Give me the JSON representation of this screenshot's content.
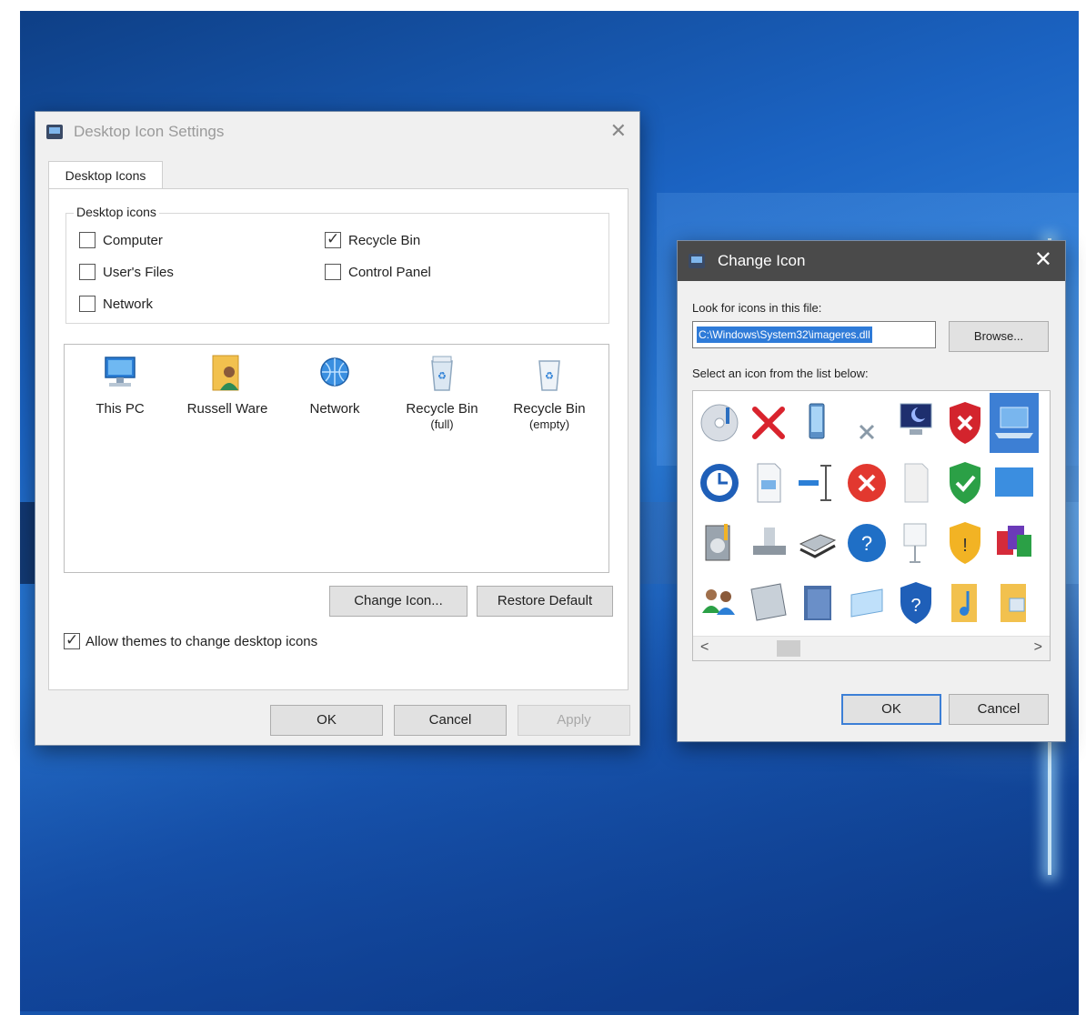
{
  "desktop_icon_settings": {
    "title": "Desktop Icon Settings",
    "close_glyph": "✕",
    "tab_label": "Desktop Icons",
    "group_label": "Desktop icons",
    "checkboxes": [
      {
        "label": "Computer",
        "checked": false
      },
      {
        "label": "Recycle Bin",
        "checked": true
      },
      {
        "label": "User's Files",
        "checked": false
      },
      {
        "label": "Control Panel",
        "checked": false
      },
      {
        "label": "Network",
        "checked": false
      }
    ],
    "icons": [
      {
        "label": "This PC",
        "sub": "",
        "icon": "pc-icon"
      },
      {
        "label": "Russell Ware",
        "sub": "",
        "icon": "user-folder-icon"
      },
      {
        "label": "Network",
        "sub": "",
        "icon": "network-icon"
      },
      {
        "label": "Recycle Bin",
        "sub": "(full)",
        "icon": "recycle-bin-full-icon"
      },
      {
        "label": "Recycle Bin",
        "sub": "(empty)",
        "icon": "recycle-bin-empty-icon"
      }
    ],
    "change_icon_button": "Change Icon...",
    "restore_default_button": "Restore Default",
    "allow_themes_label": "Allow themes to change desktop icons",
    "allow_themes_checked": true,
    "ok_button": "OK",
    "cancel_button": "Cancel",
    "apply_button": "Apply"
  },
  "change_icon": {
    "title": "Change Icon",
    "close_glyph": "✕",
    "look_label": "Look for icons in this file:",
    "path_value": "C:\\Windows\\System32\\imageres.dll",
    "browse_button": "Browse...",
    "select_label": "Select an icon from the list below:",
    "scroll_left": "<",
    "scroll_right": ">",
    "ok_button": "OK",
    "cancel_button": "Cancel",
    "grid_icons": [
      "cd-music-icon",
      "red-x-icon",
      "phone-icon",
      "small-x-icon",
      "moon-monitor-icon",
      "shield-x-icon",
      "laptop-icon",
      "clock-icon",
      "document-icon",
      "text-cursor-icon",
      "error-circle-icon",
      "blank-page-icon",
      "shield-check-icon",
      "blue-panel-icon",
      "media-device-icon",
      "drive-icon",
      "scanner-icon",
      "help-icon",
      "projector-icon",
      "shield-warning-icon",
      "programs-icon",
      "users-icon",
      "server-rack-icon",
      "blue-folder-icon",
      "glass-panel-icon",
      "shield-help-icon",
      "music-folder-icon",
      "picture-folder-icon"
    ],
    "selected_index": 6
  },
  "colors": {
    "accent": "#3c7fd6",
    "selection": "#2f7bd8",
    "desktop_blue": "#1b63c2",
    "dialog_bg": "#f0f0f0",
    "change_icon_titlebar": "#4a4a4a"
  }
}
